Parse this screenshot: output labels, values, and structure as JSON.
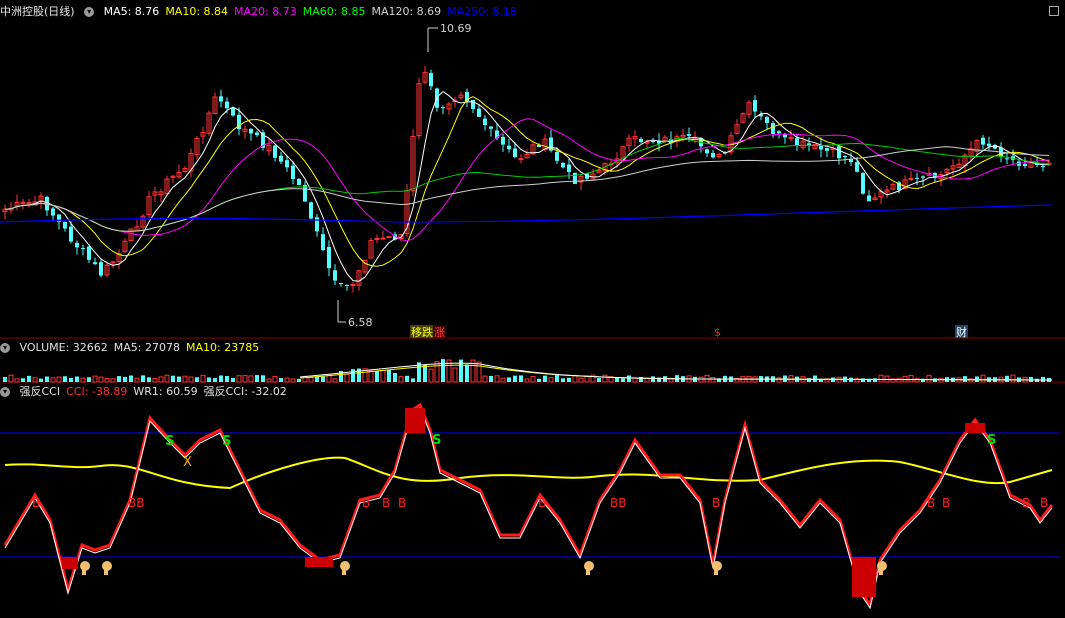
{
  "main": {
    "title": "中洲控股(日线)",
    "ma_items": [
      {
        "label": "MA5: 8.76",
        "color": "#ffffff"
      },
      {
        "label": "MA10: 8.84",
        "color": "#ffff00"
      },
      {
        "label": "MA20: 8.73",
        "color": "#ff00ff"
      },
      {
        "label": "MA60: 8.85",
        "color": "#00ff00"
      },
      {
        "label": "MA120: 8.69",
        "color": "#cfcfcf"
      },
      {
        "label": "MA250: 8.18",
        "color": "#0000ff"
      }
    ],
    "high_label": "10.69",
    "low_label": "6.58",
    "markers": [
      {
        "text": "移跌",
        "color": "#ffff00",
        "bg": "#444400"
      },
      {
        "text": "涨",
        "color": "#ff4040",
        "bg": "#440000"
      },
      {
        "text": "$",
        "color": "#ff2020",
        "bg": ""
      },
      {
        "text": "财",
        "color": "#ffffff",
        "bg": "#224466"
      }
    ]
  },
  "volume": {
    "items": [
      {
        "label": "VOLUME: 32662",
        "color": "#e0e0e0"
      },
      {
        "label": "MA5: 27078",
        "color": "#e0e0e0"
      },
      {
        "label": "MA10: 23785",
        "color": "#ffff00"
      }
    ]
  },
  "indicator": {
    "items": [
      {
        "label": "强反CCI",
        "color": "#e0e0e0"
      },
      {
        "label": "CCI: -38.89",
        "color": "#ff3030"
      },
      {
        "label": "WR1: 60.59",
        "color": "#e0e0e0"
      },
      {
        "label": "强反CCI: -32.02",
        "color": "#e0e0e0"
      }
    ],
    "signals_s": "S",
    "signals_b": "B",
    "signals_bb": "BB",
    "signals_x": "X"
  },
  "colors": {
    "up": "#ff3333",
    "down": "#54ffff",
    "ma250": "#0000ff"
  },
  "chart_data": {
    "type": "candlestick",
    "title": "中洲控股(日线)",
    "price_labels": {
      "high": 10.69,
      "low": 6.58
    },
    "ma": {
      "MA5": 8.76,
      "MA10": 8.84,
      "MA20": 8.73,
      "MA60": 8.85,
      "MA120": 8.69,
      "MA250": 8.18
    },
    "volume": {
      "VOLUME": 32662,
      "MA5": 27078,
      "MA10": 23785
    },
    "cci": {
      "CCI": -38.89,
      "WR1": 60.59,
      "强反CCI": -32.02
    }
  }
}
